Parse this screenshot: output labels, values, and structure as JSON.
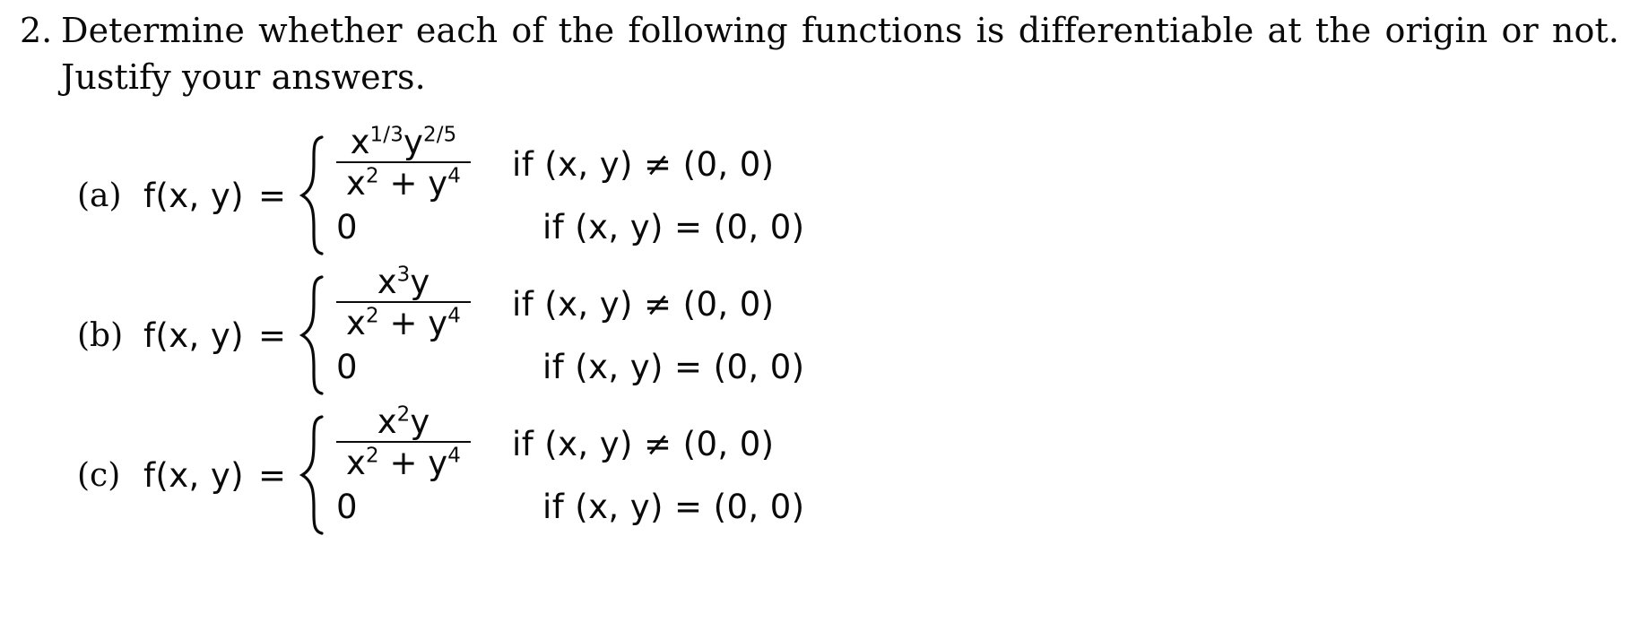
{
  "document": {
    "background_color": "#ffffff",
    "text_color": "#0a0a0a"
  },
  "problem": {
    "number": "2.",
    "line1": "Determine whether each of the following functions is differentiable at the origin or not.",
    "line2": "Justify your answers."
  },
  "math_items": [
    {
      "label": "(a)",
      "function_head": "f(x, y)",
      "equals": "=",
      "cases": [
        {
          "value_type": "fraction",
          "numerator_base": "x",
          "numerator_exp1": "1/3",
          "numerator_var2": "y",
          "numerator_exp2": "2/5",
          "denominator": "x² + y⁴",
          "denominator_base1": "x",
          "denominator_exp1": "2",
          "denominator_op": "+",
          "denominator_base2": "y",
          "denominator_exp2": "4",
          "condition": "if (x, y) ≠ (0, 0)"
        },
        {
          "value_type": "scalar",
          "value": "0",
          "condition": "if (x, y) = (0, 0)"
        }
      ]
    },
    {
      "label": "(b)",
      "function_head": "f(x, y)",
      "equals": "=",
      "cases": [
        {
          "value_type": "fraction",
          "numerator_base": "x",
          "numerator_exp1": "3",
          "numerator_var2": "y",
          "numerator_exp2": "",
          "denominator": "x² + y⁴",
          "denominator_base1": "x",
          "denominator_exp1": "2",
          "denominator_op": "+",
          "denominator_base2": "y",
          "denominator_exp2": "4",
          "condition": "if (x, y) ≠ (0, 0)"
        },
        {
          "value_type": "scalar",
          "value": "0",
          "condition": "if (x, y) = (0, 0)"
        }
      ]
    },
    {
      "label": "(c)",
      "function_head": "f(x, y)",
      "equals": "=",
      "cases": [
        {
          "value_type": "fraction",
          "numerator_base": "x",
          "numerator_exp1": "2",
          "numerator_var2": "y",
          "numerator_exp2": "",
          "denominator": "x² + y⁴",
          "denominator_base1": "x",
          "denominator_exp1": "2",
          "denominator_op": "+",
          "denominator_base2": "y",
          "denominator_exp2": "4",
          "condition": "if (x, y) ≠ (0, 0)"
        },
        {
          "value_type": "scalar",
          "value": "0",
          "condition": "if (x, y) = (0, 0)"
        }
      ]
    }
  ]
}
